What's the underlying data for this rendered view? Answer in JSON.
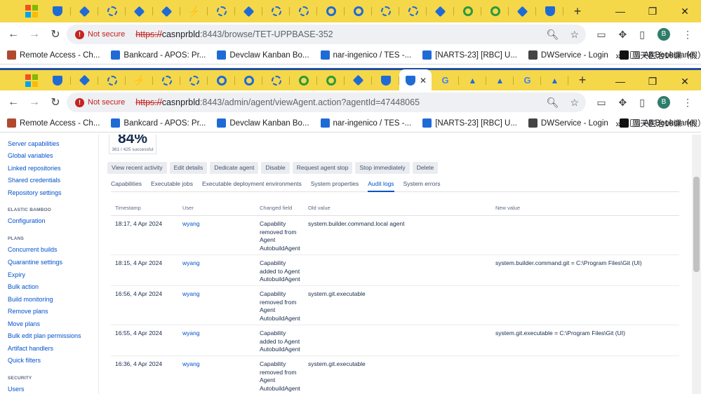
{
  "window1": {
    "url_prefix": "https://",
    "url_host": "casnprbld",
    "url_rest": ":8443/browse/TET-UPPBASE-352",
    "not_secure": "Not secure"
  },
  "window2": {
    "url_prefix": "https://",
    "url_host": "casnprbld",
    "url_rest": ":8443/admin/agent/viewAgent.action?agentId=47448065",
    "not_secure": "Not secure"
  },
  "bookmarks": [
    {
      "label": "Remote Access - Ch...",
      "icon": "dashboard-icon",
      "color": "#b04a2e"
    },
    {
      "label": "Bankcard - APOS: Pr...",
      "icon": "gear-icon",
      "color": "#1f6bd6"
    },
    {
      "label": "Devclaw Kanban Bo...",
      "icon": "jira-icon",
      "color": "#1f6bd6"
    },
    {
      "label": "nar-ingenico / TES -...",
      "icon": "shield-icon",
      "color": "#1f6bd6"
    },
    {
      "label": "[NARTS-23] [RBC] U...",
      "icon": "jira-icon",
      "color": "#1f6bd6"
    },
    {
      "label": "DWService - Login",
      "icon": "dwservice-icon",
      "color": "#444"
    },
    {
      "label": "廣天医治10课（假）",
      "icon": "notion-icon",
      "color": "#111"
    }
  ],
  "bookmarks_more": "»",
  "all_bookmarks": "All Bookmarks",
  "avatar_letter": "B",
  "sidebar": [
    {
      "type": "item",
      "label": "Server capabilities"
    },
    {
      "type": "item",
      "label": "Global variables"
    },
    {
      "type": "item",
      "label": "Linked repositories"
    },
    {
      "type": "item",
      "label": "Shared credentials"
    },
    {
      "type": "item",
      "label": "Repository settings"
    },
    {
      "type": "head",
      "label": "ELASTIC BAMBOO"
    },
    {
      "type": "item",
      "label": "Configuration"
    },
    {
      "type": "head",
      "label": "PLANS"
    },
    {
      "type": "item",
      "label": "Concurrent builds"
    },
    {
      "type": "item",
      "label": "Quarantine settings"
    },
    {
      "type": "item",
      "label": "Expiry"
    },
    {
      "type": "item",
      "label": "Bulk action"
    },
    {
      "type": "item",
      "label": "Build monitoring"
    },
    {
      "type": "item",
      "label": "Remove plans"
    },
    {
      "type": "item",
      "label": "Move plans"
    },
    {
      "type": "item",
      "label": "Bulk edit plan permissions"
    },
    {
      "type": "item",
      "label": "Artifact handlers"
    },
    {
      "type": "item",
      "label": "Quick filters"
    },
    {
      "type": "head",
      "label": "SECURITY"
    },
    {
      "type": "item",
      "label": "Users"
    }
  ],
  "stat": {
    "percent": "84%",
    "sub": "361 / 425 successful"
  },
  "actions": [
    "View recent activity",
    "Edit details",
    "Dedicate agent",
    "Disable",
    "Request agent stop",
    "Stop immediately",
    "Delete"
  ],
  "subtabs": [
    "Capabilities",
    "Executable jobs",
    "Executable deployment environments",
    "System properties",
    "Audit logs",
    "System errors"
  ],
  "active_subtab": 4,
  "audit": {
    "headers": {
      "timestamp": "Timestamp",
      "user": "User",
      "field": "Changed field",
      "old": "Old value",
      "new": "New value"
    },
    "rows": [
      {
        "ts": "18:17, 4 Apr 2024",
        "user": "wyang",
        "field": "Capability removed from Agent AutobuildAgent",
        "old": "system.builder.command.local agent",
        "new": ""
      },
      {
        "ts": "18:15, 4 Apr 2024",
        "user": "wyang",
        "field": "Capability added to Agent AutobuildAgent",
        "old": "",
        "new": "system.builder.command.git = C:\\Program Files\\Git (UI)"
      },
      {
        "ts": "16:56, 4 Apr 2024",
        "user": "wyang",
        "field": "Capability removed from Agent AutobuildAgent",
        "old": "system.git.executable",
        "new": ""
      },
      {
        "ts": "16:55, 4 Apr 2024",
        "user": "wyang",
        "field": "Capability added to Agent AutobuildAgent",
        "old": "",
        "new": "system.git.executable = C:\\Program Files\\Git (UI)"
      },
      {
        "ts": "16:36, 4 Apr 2024",
        "user": "wyang",
        "field": "Capability removed from Agent AutobuildAgent",
        "old": "system.git.executable",
        "new": ""
      }
    ]
  }
}
